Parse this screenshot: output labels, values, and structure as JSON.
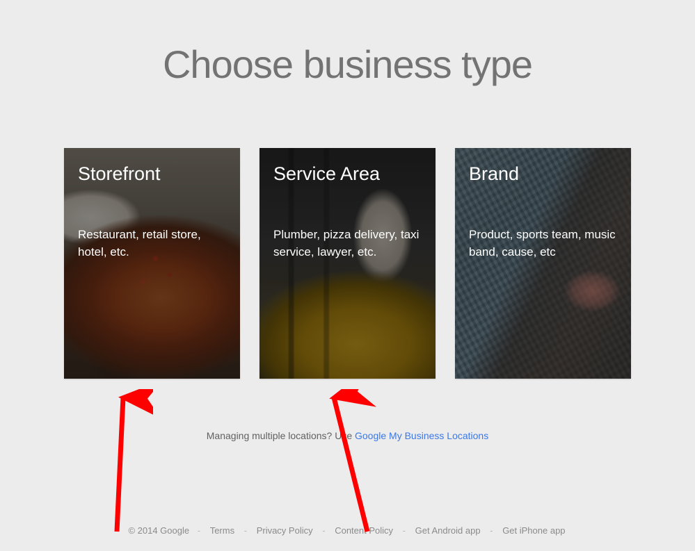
{
  "page": {
    "title": "Choose business type"
  },
  "cards": [
    {
      "title": "Storefront",
      "description": "Restaurant, retail store, hotel, etc."
    },
    {
      "title": "Service Area",
      "description": "Plumber, pizza delivery, taxi service, lawyer, etc."
    },
    {
      "title": "Brand",
      "description": "Product, sports team, music band, cause, etc"
    }
  ],
  "multi_locations": {
    "prefix": "Managing multiple locations? Use ",
    "link_text": "Google My Business Locations"
  },
  "footer": {
    "copyright": "© 2014 Google",
    "links": [
      "Terms",
      "Privacy Policy",
      "Content Policy",
      "Get Android app",
      "Get iPhone app"
    ],
    "separator": "-"
  },
  "annotations": {
    "arrow_color": "#ff0000"
  }
}
